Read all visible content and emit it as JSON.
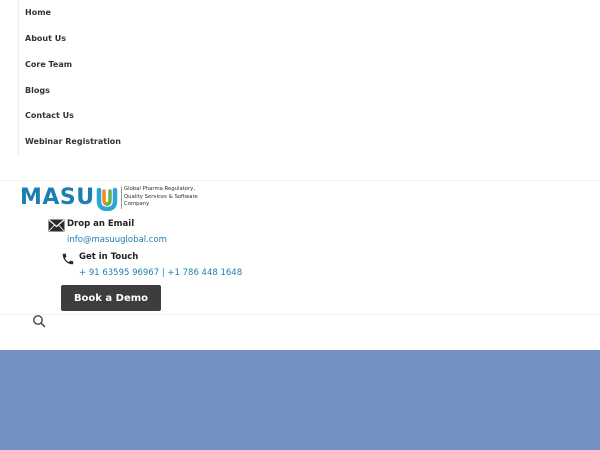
{
  "nav": {
    "items": [
      {
        "label": "Home"
      },
      {
        "label": "About Us"
      },
      {
        "label": "Core Team"
      },
      {
        "label": "Blogs"
      },
      {
        "label": "Contact Us"
      },
      {
        "label": "Webinar Registration"
      }
    ]
  },
  "brand": {
    "wordmark": "MASU",
    "tagline_line1": "Global Pharma Regulatory,",
    "tagline_line2": "Quality Services & Software",
    "tagline_line3": "Company",
    "mark_colors": [
      "#2aa6d8",
      "#f28a1d",
      "#6ab04c"
    ],
    "primary_color": "#1c7fb4"
  },
  "contact": {
    "email_title": "Drop an Email",
    "email": "info@masuuglobal.com",
    "email_icon": "envelope-icon",
    "phone_title": "Get in Touch",
    "phones": "+ 91 63595 96967 | +1 786 448 1648",
    "phone_icon": "phone-icon"
  },
  "cta": {
    "demo_label": "Book a Demo"
  },
  "search": {
    "icon": "search-icon"
  },
  "hero": {
    "background": "#7291c1"
  }
}
